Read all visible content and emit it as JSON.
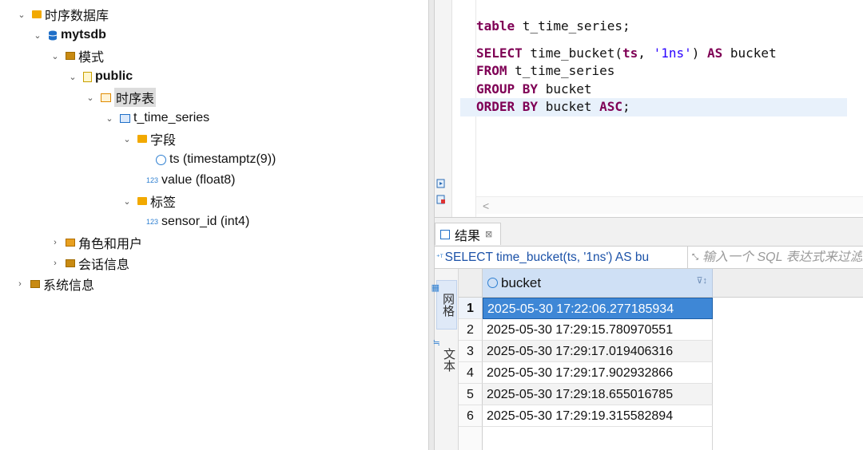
{
  "tree": {
    "nodes": [
      {
        "label": "时序数据库",
        "chevron": "⌄",
        "icon": "folder-icon"
      },
      {
        "label": "mytsdb",
        "chevron": "⌄",
        "icon": "database-icon"
      },
      {
        "label": "模式",
        "chevron": "⌄",
        "icon": "schema-folder-icon"
      },
      {
        "label": "public",
        "chevron": "⌄",
        "icon": "schema-icon"
      },
      {
        "label": "时序表",
        "chevron": "⌄",
        "icon": "timeseries-folder-icon"
      },
      {
        "label": "t_time_series",
        "chevron": "⌄",
        "icon": "table-icon"
      },
      {
        "label": "字段",
        "chevron": "⌄",
        "icon": "columns-folder-icon"
      },
      {
        "label": "ts (timestamptz(9))",
        "icon": "clock-icon"
      },
      {
        "label": "value (float8)",
        "icon_text": "123",
        "icon": "numeric-icon"
      },
      {
        "label": "标签",
        "chevron": "⌄",
        "icon": "tags-folder-icon"
      },
      {
        "label": "sensor_id (int4)",
        "icon_text": "123",
        "icon": "numeric-icon"
      },
      {
        "label": "角色和用户",
        "chevron": "›",
        "icon": "roles-folder-icon"
      },
      {
        "label": "会话信息",
        "chevron": "›",
        "icon": "sessions-folder-icon"
      },
      {
        "label": "系统信息",
        "chevron": "›",
        "icon": "system-folder-icon"
      }
    ]
  },
  "editor": {
    "line1": {
      "kw": "table",
      "rest": " t_time_series;"
    },
    "line2": {
      "kw1": "SELECT",
      "a": " time_bucket(",
      "b": "ts",
      "c": ", ",
      "str": "'1ns'",
      "d": ") ",
      "kw2": "AS",
      "e": " bucket"
    },
    "line3": {
      "kw": "FROM",
      "rest": " t_time_series"
    },
    "line4": {
      "kw": "GROUP BY",
      "rest": " bucket"
    },
    "line5": {
      "kw1": "ORDER BY",
      "a": " bucket ",
      "kw2": "ASC",
      "b": ";"
    },
    "scroll_left": "<"
  },
  "results": {
    "tab_label": "结果",
    "tab_close": "⊠",
    "query_icon": "⁺ᵀ",
    "query_text": "SELECT time_bucket(ts, '1ns') AS bu",
    "expand_glyph": "⤡",
    "filter_placeholder": "输入一个 SQL 表达式来过滤",
    "side_tabs": {
      "grid": "网格",
      "text": "文本"
    },
    "column_header": "bucket",
    "rows": [
      {
        "num": "1",
        "value": "2025-05-30 17:22:06.277185934"
      },
      {
        "num": "2",
        "value": "2025-05-30 17:29:15.780970551"
      },
      {
        "num": "3",
        "value": "2025-05-30 17:29:17.019406316"
      },
      {
        "num": "4",
        "value": "2025-05-30 17:29:17.902932866"
      },
      {
        "num": "5",
        "value": "2025-05-30 17:29:18.655016785"
      },
      {
        "num": "6",
        "value": "2025-05-30 17:29:19.315582894"
      }
    ]
  },
  "colors": {
    "selection": "#3e87d6",
    "keyword": "#7f0055",
    "string": "#2a00ff",
    "link": "#1c52a8"
  }
}
